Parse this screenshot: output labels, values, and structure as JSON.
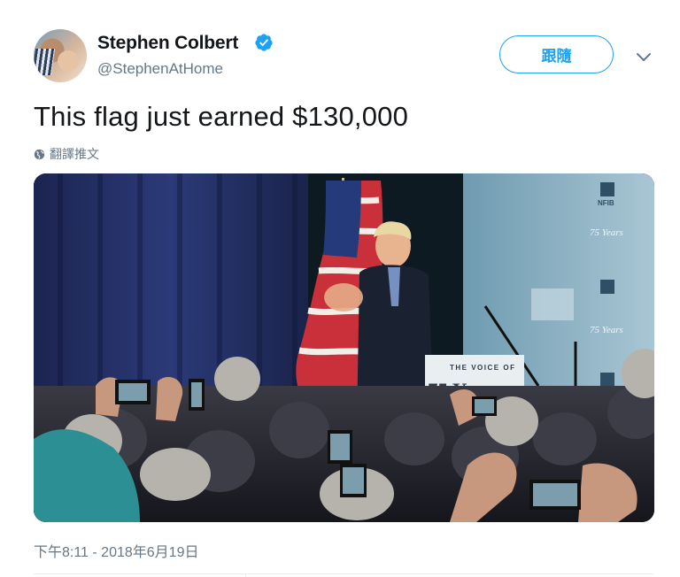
{
  "author": {
    "display_name": "Stephen Colbert",
    "handle": "@StephenAtHome",
    "verified": true
  },
  "follow_button": {
    "label": "跟隨"
  },
  "tweet": {
    "text": "This flag just earned $130,000",
    "translate_label": "翻譯推文",
    "timestamp": "下午8:11 - 2018年6月19日"
  },
  "media": {
    "podium_sign_top": "THE VOICE OF",
    "podium_sign_main": "75 Years",
    "backdrop_logo": "NFIB",
    "backdrop_years": "75 Years"
  },
  "icons": {
    "verified": "verified-badge-icon",
    "menu": "chevron-down-icon",
    "translate": "globe-icon"
  },
  "colors": {
    "accent": "#1da1f2",
    "secondary_text": "#657786",
    "primary_text": "#14171a"
  }
}
